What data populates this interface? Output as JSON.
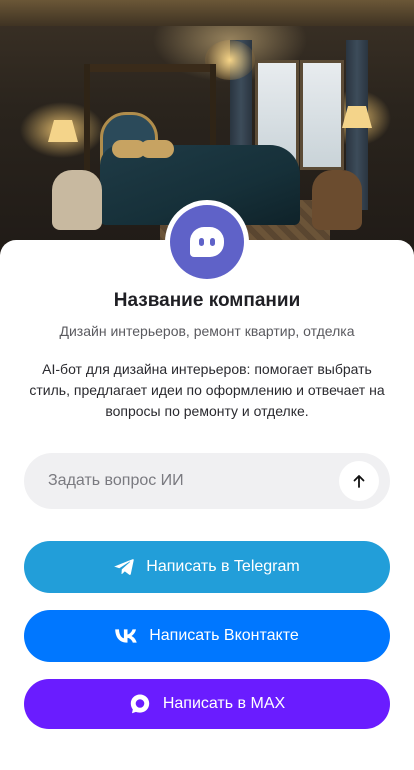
{
  "company": {
    "name": "Название компании",
    "tagline": "Дизайн интерьеров, ремонт квартир, отделка",
    "description": "AI-бот для дизайна интерьеров: помогает выбрать стиль, предлагает идеи по оформлению и отвечает на вопросы по ремонту и отделке."
  },
  "ask": {
    "placeholder": "Задать вопрос ИИ",
    "value": ""
  },
  "buttons": {
    "telegram": "Написать в Telegram",
    "vk": "Написать Вконтакте",
    "max": "Написать в MAX"
  },
  "icons": {
    "avatar": "bot-chat-icon",
    "send": "arrow-up-icon",
    "telegram": "telegram-plane-icon",
    "vk": "vk-logo-icon",
    "max": "max-chat-icon"
  },
  "colors": {
    "avatar": "#5f62c8",
    "telegram": "#229ed9",
    "vk": "#0077ff",
    "max": "#6a1cff",
    "ask_bg": "#f0f0f2"
  }
}
